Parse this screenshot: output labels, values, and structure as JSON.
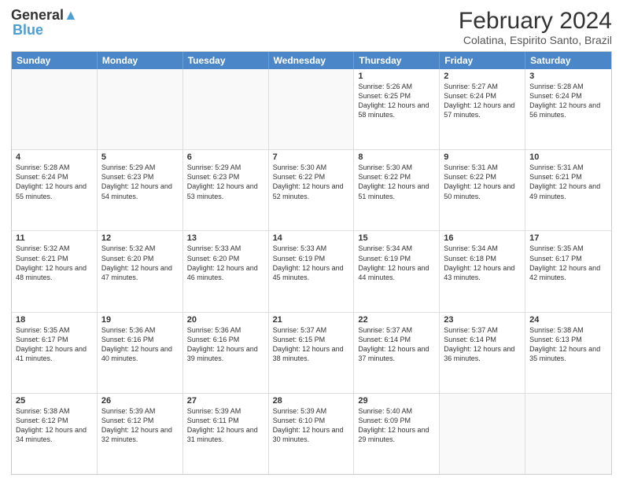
{
  "logo": {
    "line1": "General",
    "line2": "Blue"
  },
  "title": "February 2024",
  "subtitle": "Colatina, Espirito Santo, Brazil",
  "days": [
    "Sunday",
    "Monday",
    "Tuesday",
    "Wednesday",
    "Thursday",
    "Friday",
    "Saturday"
  ],
  "rows": [
    [
      {
        "num": "",
        "text": ""
      },
      {
        "num": "",
        "text": ""
      },
      {
        "num": "",
        "text": ""
      },
      {
        "num": "",
        "text": ""
      },
      {
        "num": "1",
        "text": "Sunrise: 5:26 AM\nSunset: 6:25 PM\nDaylight: 12 hours and 58 minutes."
      },
      {
        "num": "2",
        "text": "Sunrise: 5:27 AM\nSunset: 6:24 PM\nDaylight: 12 hours and 57 minutes."
      },
      {
        "num": "3",
        "text": "Sunrise: 5:28 AM\nSunset: 6:24 PM\nDaylight: 12 hours and 56 minutes."
      }
    ],
    [
      {
        "num": "4",
        "text": "Sunrise: 5:28 AM\nSunset: 6:24 PM\nDaylight: 12 hours and 55 minutes."
      },
      {
        "num": "5",
        "text": "Sunrise: 5:29 AM\nSunset: 6:23 PM\nDaylight: 12 hours and 54 minutes."
      },
      {
        "num": "6",
        "text": "Sunrise: 5:29 AM\nSunset: 6:23 PM\nDaylight: 12 hours and 53 minutes."
      },
      {
        "num": "7",
        "text": "Sunrise: 5:30 AM\nSunset: 6:22 PM\nDaylight: 12 hours and 52 minutes."
      },
      {
        "num": "8",
        "text": "Sunrise: 5:30 AM\nSunset: 6:22 PM\nDaylight: 12 hours and 51 minutes."
      },
      {
        "num": "9",
        "text": "Sunrise: 5:31 AM\nSunset: 6:22 PM\nDaylight: 12 hours and 50 minutes."
      },
      {
        "num": "10",
        "text": "Sunrise: 5:31 AM\nSunset: 6:21 PM\nDaylight: 12 hours and 49 minutes."
      }
    ],
    [
      {
        "num": "11",
        "text": "Sunrise: 5:32 AM\nSunset: 6:21 PM\nDaylight: 12 hours and 48 minutes."
      },
      {
        "num": "12",
        "text": "Sunrise: 5:32 AM\nSunset: 6:20 PM\nDaylight: 12 hours and 47 minutes."
      },
      {
        "num": "13",
        "text": "Sunrise: 5:33 AM\nSunset: 6:20 PM\nDaylight: 12 hours and 46 minutes."
      },
      {
        "num": "14",
        "text": "Sunrise: 5:33 AM\nSunset: 6:19 PM\nDaylight: 12 hours and 45 minutes."
      },
      {
        "num": "15",
        "text": "Sunrise: 5:34 AM\nSunset: 6:19 PM\nDaylight: 12 hours and 44 minutes."
      },
      {
        "num": "16",
        "text": "Sunrise: 5:34 AM\nSunset: 6:18 PM\nDaylight: 12 hours and 43 minutes."
      },
      {
        "num": "17",
        "text": "Sunrise: 5:35 AM\nSunset: 6:17 PM\nDaylight: 12 hours and 42 minutes."
      }
    ],
    [
      {
        "num": "18",
        "text": "Sunrise: 5:35 AM\nSunset: 6:17 PM\nDaylight: 12 hours and 41 minutes."
      },
      {
        "num": "19",
        "text": "Sunrise: 5:36 AM\nSunset: 6:16 PM\nDaylight: 12 hours and 40 minutes."
      },
      {
        "num": "20",
        "text": "Sunrise: 5:36 AM\nSunset: 6:16 PM\nDaylight: 12 hours and 39 minutes."
      },
      {
        "num": "21",
        "text": "Sunrise: 5:37 AM\nSunset: 6:15 PM\nDaylight: 12 hours and 38 minutes."
      },
      {
        "num": "22",
        "text": "Sunrise: 5:37 AM\nSunset: 6:14 PM\nDaylight: 12 hours and 37 minutes."
      },
      {
        "num": "23",
        "text": "Sunrise: 5:37 AM\nSunset: 6:14 PM\nDaylight: 12 hours and 36 minutes."
      },
      {
        "num": "24",
        "text": "Sunrise: 5:38 AM\nSunset: 6:13 PM\nDaylight: 12 hours and 35 minutes."
      }
    ],
    [
      {
        "num": "25",
        "text": "Sunrise: 5:38 AM\nSunset: 6:12 PM\nDaylight: 12 hours and 34 minutes."
      },
      {
        "num": "26",
        "text": "Sunrise: 5:39 AM\nSunset: 6:12 PM\nDaylight: 12 hours and 32 minutes."
      },
      {
        "num": "27",
        "text": "Sunrise: 5:39 AM\nSunset: 6:11 PM\nDaylight: 12 hours and 31 minutes."
      },
      {
        "num": "28",
        "text": "Sunrise: 5:39 AM\nSunset: 6:10 PM\nDaylight: 12 hours and 30 minutes."
      },
      {
        "num": "29",
        "text": "Sunrise: 5:40 AM\nSunset: 6:09 PM\nDaylight: 12 hours and 29 minutes."
      },
      {
        "num": "",
        "text": ""
      },
      {
        "num": "",
        "text": ""
      }
    ]
  ]
}
